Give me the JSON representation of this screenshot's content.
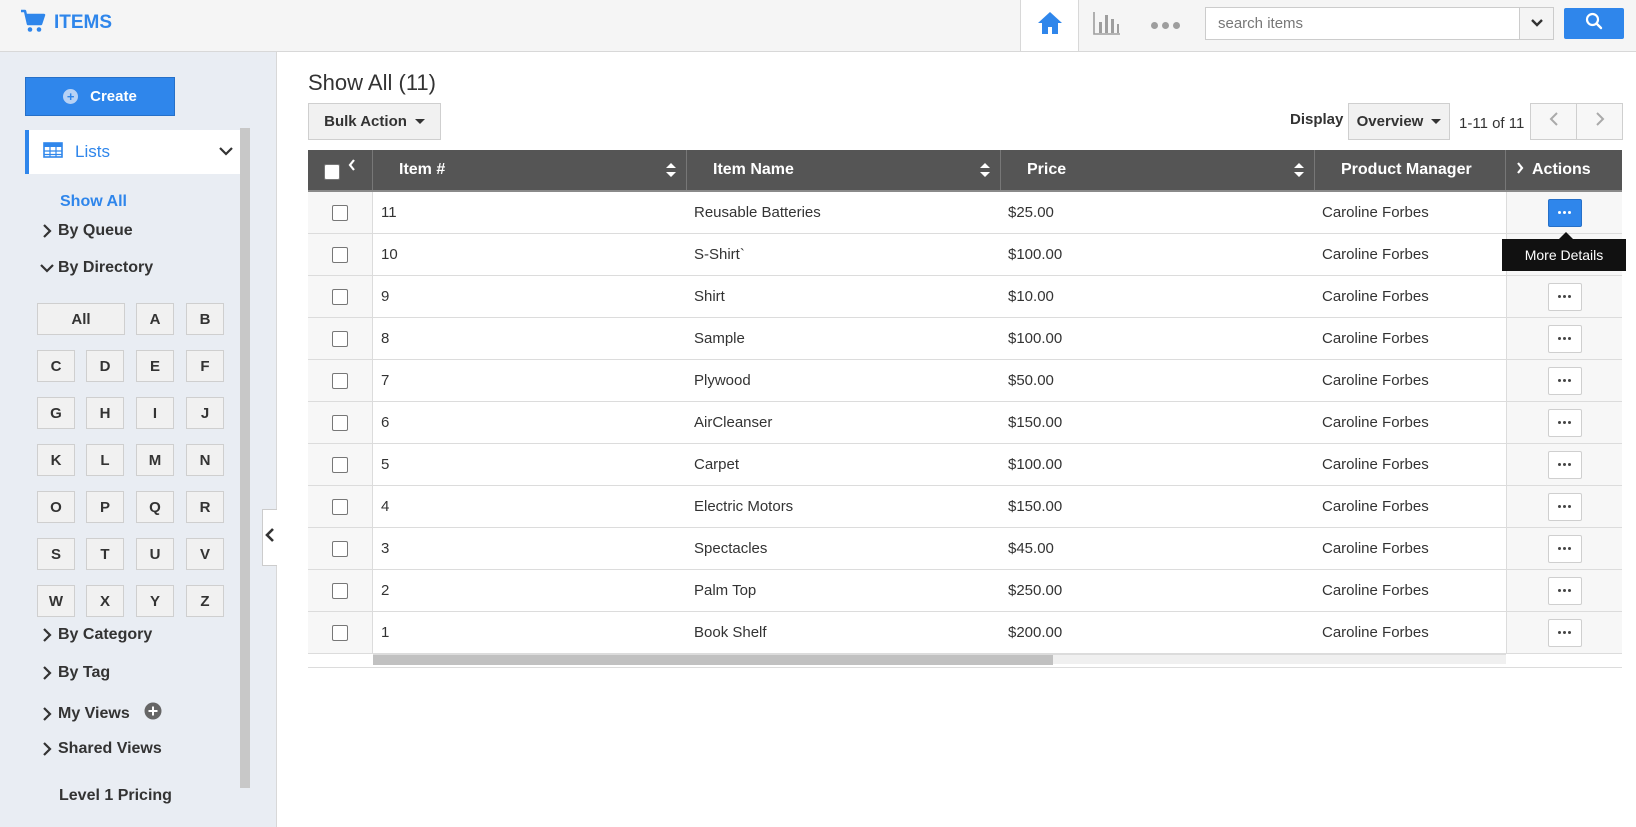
{
  "app": {
    "title": "ITEMS",
    "brand_color": "#2f86eb"
  },
  "header": {
    "search_placeholder": "search items",
    "nav_icons": [
      "home-icon",
      "bar-chart-icon",
      "more-dots-icon"
    ]
  },
  "sidebar": {
    "create_label": "Create",
    "lists_label": "Lists",
    "show_all_label": "Show All",
    "by_queue": "By Queue",
    "by_directory": "By Directory",
    "directory_buttons": [
      "All",
      "A",
      "B",
      "C",
      "D",
      "E",
      "F",
      "G",
      "H",
      "I",
      "J",
      "K",
      "L",
      "M",
      "N",
      "O",
      "P",
      "Q",
      "R",
      "S",
      "T",
      "U",
      "V",
      "W",
      "X",
      "Y",
      "Z"
    ],
    "by_category": "By Category",
    "by_tag": "By Tag",
    "my_views": "My Views",
    "shared_views": "Shared Views",
    "level1_pricing": "Level 1 Pricing"
  },
  "main": {
    "title": "Show All (11)",
    "bulk_action_label": "Bulk Action",
    "display_label": "Display",
    "display_value": "Overview",
    "paging_text": "1-11 of 11"
  },
  "table": {
    "columns": [
      "Item #",
      "Item Name",
      "Price",
      "Product Manager",
      "Actions"
    ],
    "rows": [
      {
        "num": "11",
        "name": "Reusable Batteries",
        "price": "$25.00",
        "manager": "Caroline Forbes"
      },
      {
        "num": "10",
        "name": "S-Shirt`",
        "price": "$100.00",
        "manager": "Caroline Forbes"
      },
      {
        "num": "9",
        "name": "Shirt",
        "price": "$10.00",
        "manager": "Caroline Forbes"
      },
      {
        "num": "8",
        "name": "Sample",
        "price": "$100.00",
        "manager": "Caroline Forbes"
      },
      {
        "num": "7",
        "name": "Plywood",
        "price": "$50.00",
        "manager": "Caroline Forbes"
      },
      {
        "num": "6",
        "name": "AirCleanser",
        "price": "$150.00",
        "manager": "Caroline Forbes"
      },
      {
        "num": "5",
        "name": "Carpet",
        "price": "$100.00",
        "manager": "Caroline Forbes"
      },
      {
        "num": "4",
        "name": "Electric Motors",
        "price": "$150.00",
        "manager": "Caroline Forbes"
      },
      {
        "num": "3",
        "name": "Spectacles",
        "price": "$45.00",
        "manager": "Caroline Forbes"
      },
      {
        "num": "2",
        "name": "Palm Top",
        "price": "$250.00",
        "manager": "Caroline Forbes"
      },
      {
        "num": "1",
        "name": "Book Shelf",
        "price": "$200.00",
        "manager": "Caroline Forbes"
      }
    ]
  },
  "tooltip": {
    "text": "More Details"
  }
}
